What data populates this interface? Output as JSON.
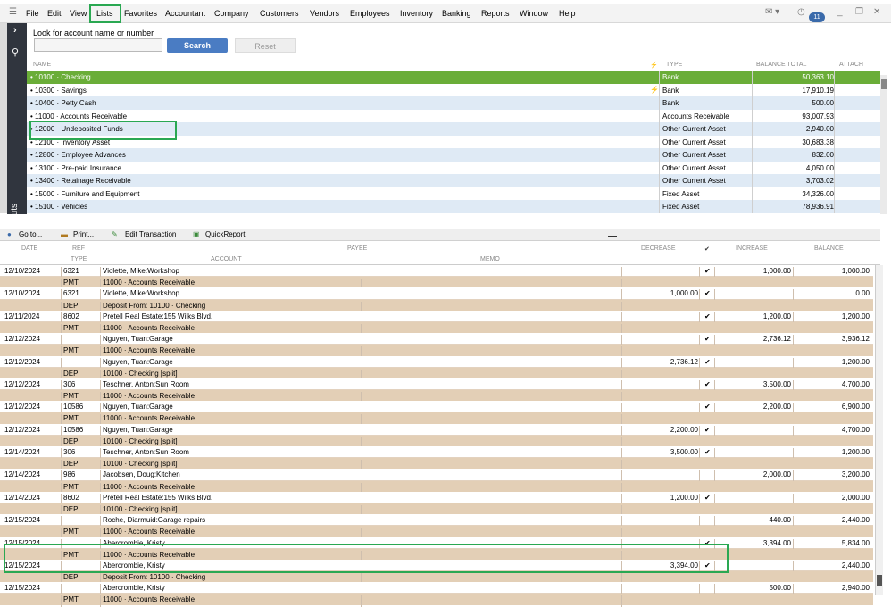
{
  "menu": [
    "File",
    "Edit",
    "View",
    "Lists",
    "Favorites",
    "Accountant",
    "Company",
    "Customers",
    "Vendors",
    "Employees",
    "Inventory",
    "Banking",
    "Reports",
    "Window",
    "Help"
  ],
  "badge_count": "11",
  "sidebar_label": "ortcuts",
  "search": {
    "label": "Look for account name or number",
    "search_button": "Search",
    "reset_button": "Reset"
  },
  "account_headers": {
    "name": "NAME",
    "type": "TYPE",
    "balance": "BALANCE TOTAL",
    "attach": "ATTACH"
  },
  "accounts": [
    {
      "name": "10100 · Checking",
      "type": "Bank",
      "balance": "50,363.10",
      "selected": true
    },
    {
      "name": "10300 · Savings",
      "type": "Bank",
      "balance": "17,910.19",
      "flash": true
    },
    {
      "name": "10400 · Petty Cash",
      "type": "Bank",
      "balance": "500.00"
    },
    {
      "name": "11000 · Accounts Receivable",
      "type": "Accounts Receivable",
      "balance": "93,007.93"
    },
    {
      "name": "12000 · Undeposited Funds",
      "type": "Other Current Asset",
      "balance": "2,940.00"
    },
    {
      "name": "12100 · Inventory Asset",
      "type": "Other Current Asset",
      "balance": "30,683.38"
    },
    {
      "name": "12800 · Employee Advances",
      "type": "Other Current Asset",
      "balance": "832.00"
    },
    {
      "name": "13100 · Pre-paid Insurance",
      "type": "Other Current Asset",
      "balance": "4,050.00"
    },
    {
      "name": "13400 · Retainage Receivable",
      "type": "Other Current Asset",
      "balance": "3,703.02"
    },
    {
      "name": "15000 · Furniture and Equipment",
      "type": "Fixed Asset",
      "balance": "34,326.00"
    },
    {
      "name": "15100 · Vehicles",
      "type": "Fixed Asset",
      "balance": "78,936.91"
    }
  ],
  "toolbar": {
    "goto": "Go to...",
    "print": "Print...",
    "edit": "Edit Transaction",
    "quickreport": "QuickReport"
  },
  "tx_headers": {
    "date": "DATE",
    "ref": "REF",
    "type": "TYPE",
    "payee": "PAYEE",
    "account": "ACCOUNT",
    "memo": "MEMO",
    "decrease": "DECREASE",
    "increase": "INCREASE",
    "balance": "BALANCE"
  },
  "transactions": [
    {
      "date": "12/10/2024",
      "ref": "6321",
      "payee": "Violette, Mike:Workshop",
      "type": "PMT",
      "account": "11000 · Accounts Receivable",
      "decrease": "",
      "check": true,
      "increase": "1,000.00",
      "balance": "1,000.00"
    },
    {
      "date": "12/10/2024",
      "ref": "6321",
      "payee": "Violette, Mike:Workshop",
      "type": "DEP",
      "account": "Deposit From: 10100 · Checking",
      "decrease": "1,000.00",
      "check": true,
      "increase": "",
      "balance": "0.00"
    },
    {
      "date": "12/11/2024",
      "ref": "8602",
      "payee": "Pretell Real Estate:155 Wilks Blvd.",
      "type": "PMT",
      "account": "11000 · Accounts Receivable",
      "decrease": "",
      "check": true,
      "increase": "1,200.00",
      "balance": "1,200.00"
    },
    {
      "date": "12/12/2024",
      "ref": "",
      "payee": "Nguyen, Tuan:Garage",
      "type": "PMT",
      "account": "11000 · Accounts Receivable",
      "decrease": "",
      "check": true,
      "increase": "2,736.12",
      "balance": "3,936.12"
    },
    {
      "date": "12/12/2024",
      "ref": "",
      "payee": "Nguyen, Tuan:Garage",
      "type": "DEP",
      "account": "10100 · Checking [split]",
      "decrease": "2,736.12",
      "check": true,
      "increase": "",
      "balance": "1,200.00"
    },
    {
      "date": "12/12/2024",
      "ref": "306",
      "payee": "Teschner, Anton:Sun Room",
      "type": "PMT",
      "account": "11000 · Accounts Receivable",
      "decrease": "",
      "check": true,
      "increase": "3,500.00",
      "balance": "4,700.00"
    },
    {
      "date": "12/12/2024",
      "ref": "10586",
      "payee": "Nguyen, Tuan:Garage",
      "type": "PMT",
      "account": "11000 · Accounts Receivable",
      "decrease": "",
      "check": true,
      "increase": "2,200.00",
      "balance": "6,900.00"
    },
    {
      "date": "12/12/2024",
      "ref": "10586",
      "payee": "Nguyen, Tuan:Garage",
      "type": "DEP",
      "account": "10100 · Checking [split]",
      "decrease": "2,200.00",
      "check": true,
      "increase": "",
      "balance": "4,700.00"
    },
    {
      "date": "12/14/2024",
      "ref": "306",
      "payee": "Teschner, Anton:Sun Room",
      "type": "DEP",
      "account": "10100 · Checking [split]",
      "decrease": "3,500.00",
      "check": true,
      "increase": "",
      "balance": "1,200.00"
    },
    {
      "date": "12/14/2024",
      "ref": "986",
      "payee": "Jacobsen, Doug:Kitchen",
      "type": "PMT",
      "account": "11000 · Accounts Receivable",
      "decrease": "",
      "check": false,
      "increase": "2,000.00",
      "balance": "3,200.00"
    },
    {
      "date": "12/14/2024",
      "ref": "8602",
      "payee": "Pretell Real Estate:155 Wilks Blvd.",
      "type": "DEP",
      "account": "10100 · Checking [split]",
      "decrease": "1,200.00",
      "check": true,
      "increase": "",
      "balance": "2,000.00"
    },
    {
      "date": "12/15/2024",
      "ref": "",
      "payee": "Roche, Diarmuid:Garage repairs",
      "type": "PMT",
      "account": "11000 · Accounts Receivable",
      "decrease": "",
      "check": false,
      "increase": "440.00",
      "balance": "2,440.00"
    },
    {
      "date": "12/15/2024",
      "ref": "",
      "payee": "Abercrombie, Kristy",
      "type": "PMT",
      "account": "11000 · Accounts Receivable",
      "decrease": "",
      "check": true,
      "increase": "3,394.00",
      "balance": "5,834.00"
    },
    {
      "date": "12/15/2024",
      "ref": "",
      "payee": "Abercrombie, Kristy",
      "type": "DEP",
      "account": "Deposit From: 10100 · Checking",
      "decrease": "3,394.00",
      "check": true,
      "increase": "",
      "balance": "2,440.00"
    },
    {
      "date": "12/15/2024",
      "ref": "",
      "payee": "Abercrombie, Kristy",
      "type": "PMT",
      "account": "11000 · Accounts Receivable",
      "decrease": "",
      "check": false,
      "increase": "500.00",
      "balance": "2,940.00"
    }
  ]
}
